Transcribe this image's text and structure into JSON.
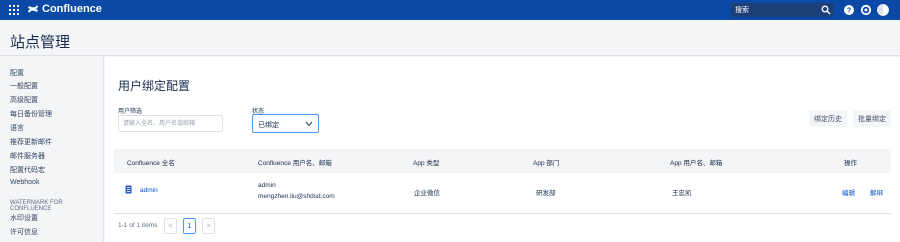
{
  "topbar": {
    "app_name": "Confluence",
    "search_placeholder": "搜索"
  },
  "page": {
    "title": "站点管理"
  },
  "sidebar": {
    "items": [
      {
        "label": "配置"
      },
      {
        "label": "一般配置"
      },
      {
        "label": "高级配置"
      },
      {
        "label": "每日备份管理"
      },
      {
        "label": "语言"
      },
      {
        "label": "推荐更新邮件"
      },
      {
        "label": "邮件服务器"
      },
      {
        "label": "配置代码宏"
      },
      {
        "label": "Webhook"
      }
    ],
    "group_title": "WATERMARK FOR CONFLUENCE",
    "group_items": [
      {
        "label": "水印设置"
      },
      {
        "label": "许可信息"
      }
    ]
  },
  "main": {
    "title": "用户绑定配置",
    "filter_user_label": "用户筛选",
    "filter_user_placeholder": "请输入全名、用户名或邮箱",
    "filter_status_label": "状态",
    "filter_status_value": "已绑定",
    "btn_history": "绑定历史",
    "btn_batch": "批量绑定",
    "table": {
      "headers": [
        "Confluence 全名",
        "Confluence 用户名、邮箱",
        "App 类型",
        "App 部门",
        "App 用户名、邮箱",
        "操作"
      ],
      "rows": [
        {
          "fullname": "admin",
          "username": "admin",
          "email": "mengzhen.liu@shdsd.com",
          "app_type": "企业微信",
          "app_dept": "研发部",
          "app_user": "王忠凯",
          "action_edit": "编辑",
          "action_unbind": "解绑"
        }
      ]
    },
    "pagination": {
      "summary": "1-1 of 1 items",
      "prev": "<",
      "current": "1",
      "next": ">"
    }
  },
  "colors": {
    "topbar": "#0a49a6",
    "link": "#0052cc",
    "select_border": "#4c9aff"
  }
}
